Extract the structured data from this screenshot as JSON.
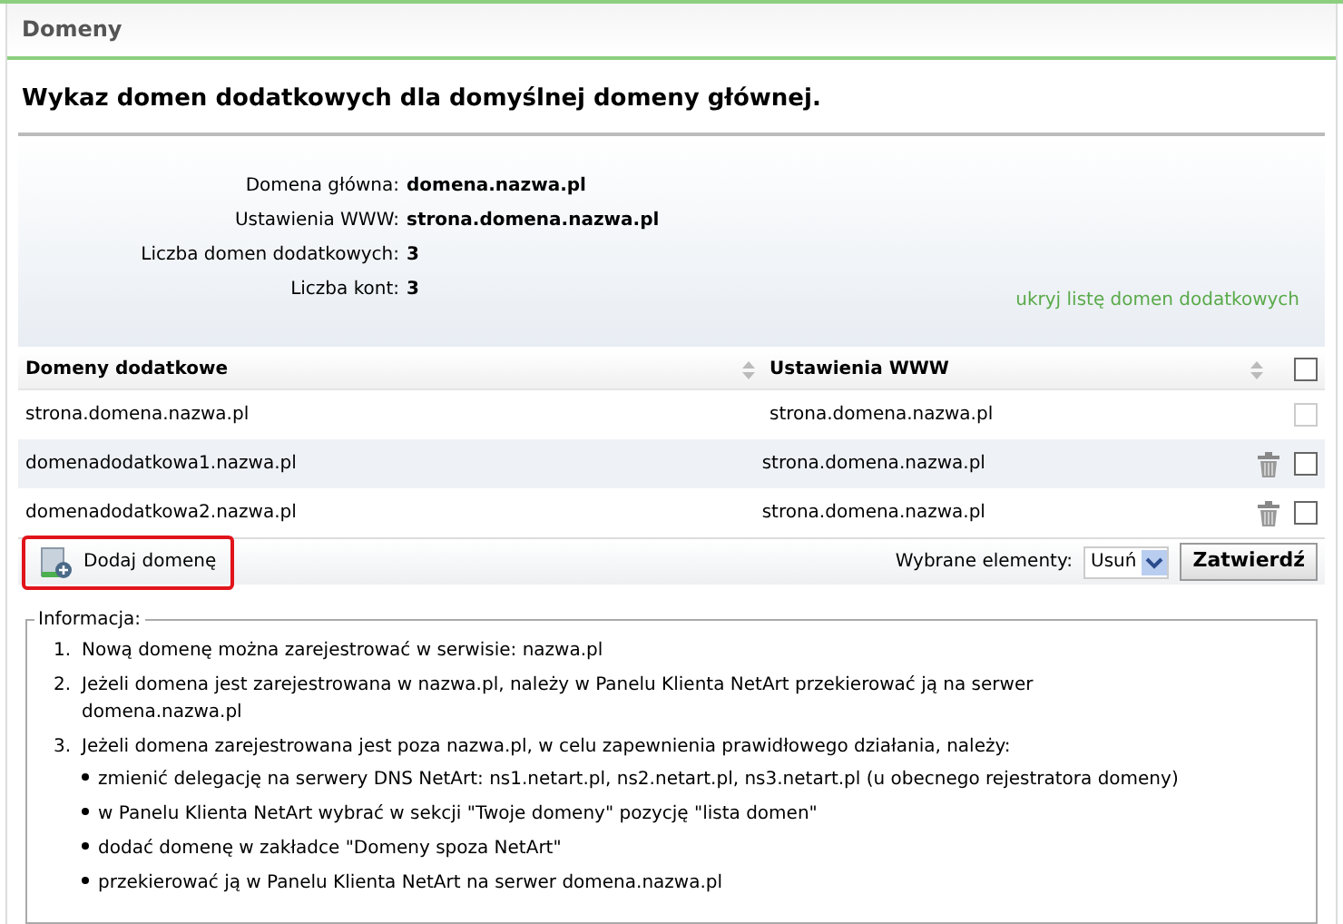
{
  "panel": {
    "title": "Domeny"
  },
  "heading": "Wykaz domen dodatkowych dla domyślnej domeny głównej.",
  "summary": [
    {
      "label": "Domena główna:",
      "value": "domena.nazwa.pl"
    },
    {
      "label": "Ustawienia WWW:",
      "value": "strona.domena.nazwa.pl"
    },
    {
      "label": "Liczba domen dodatkowych:",
      "value": "3"
    },
    {
      "label": "Liczba kont:",
      "value": "3"
    }
  ],
  "toggle_link": "ukryj listę domen dodatkowych",
  "table": {
    "columns": [
      "Domeny dodatkowe",
      "Ustawienia WWW"
    ],
    "select_all": {
      "checked": false
    },
    "rows": [
      {
        "domain": "strona.domena.nazwa.pl",
        "www": "strona.domena.nazwa.pl",
        "deletable": false,
        "checked": false
      },
      {
        "domain": "domenadodatkowa1.nazwa.pl",
        "www": "strona.domena.nazwa.pl",
        "deletable": true,
        "checked": false
      },
      {
        "domain": "domenadodatkowa2.nazwa.pl",
        "www": "strona.domena.nazwa.pl",
        "deletable": true,
        "checked": false
      }
    ]
  },
  "add_button": {
    "label": "Dodaj domenę",
    "highlighted": true
  },
  "bulk": {
    "label": "Wybrane elementy:",
    "action": "Usuń",
    "submit": "Zatwierdź"
  },
  "info": {
    "legend": "Informacja:",
    "items": [
      {
        "number": "1.",
        "text": "Nową domenę można zarejestrować w serwisie: nazwa.pl"
      },
      {
        "number": "2.",
        "text": "Jeżeli domena jest zarejestrowana w nazwa.pl, należy w Panelu Klienta NetArt przekierować ją na serwer domena.nazwa.pl"
      },
      {
        "number": "3.",
        "text": "Jeżeli domena zarejestrowana jest poza nazwa.pl, w celu zapewnienia prawidłowego działania, należy:",
        "children": [
          "zmienić delegację na serwery DNS NetArt: ns1.netart.pl, ns2.netart.pl, ns3.netart.pl (u obecnego rejestratora domeny)",
          "w Panelu Klienta NetArt wybrać w sekcji \"Twoje domeny\" pozycję \"lista domen\"",
          "dodać domenę w zakładce \"Domeny spoza NetArt\"",
          "przekierować ją w Panelu Klienta NetArt na serwer domena.nazwa.pl"
        ]
      }
    ]
  }
}
